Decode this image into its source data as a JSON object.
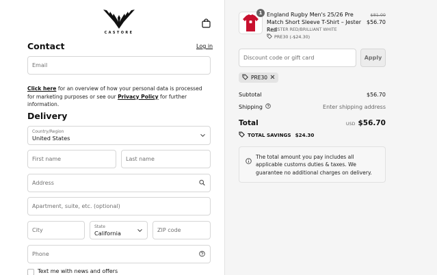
{
  "header": {
    "brand": "CASTORE"
  },
  "contact": {
    "heading": "Contact",
    "login_label": "Log in",
    "email_placeholder": "Email"
  },
  "privacy_note": {
    "link1": "Click here",
    "text1": " for an overview of how your personal data is processed for marketing purposes or see our ",
    "link2": "Privacy Policy",
    "text2": " for further information."
  },
  "delivery": {
    "heading": "Delivery",
    "country_label": "Country/Region",
    "country_value": "United States",
    "first_name_placeholder": "First name",
    "last_name_placeholder": "Last name",
    "address_placeholder": "Address",
    "apartment_placeholder": "Apartment, suite, etc. (optional)",
    "city_placeholder": "City",
    "state_label": "State",
    "state_value": "California",
    "zip_placeholder": "ZIP code",
    "phone_placeholder": "Phone",
    "sms_label": "Text me with news and offers"
  },
  "cart": {
    "item": {
      "quantity": "1",
      "name": "England Rugby Men's 25/26 Pre Match Short Sleeve T-Shirt – Jester Red",
      "variant": "S / JESTER RED/BRILLIANT WHITE",
      "discount": "PRE30 (-$24.30)",
      "original_price": "$81.00",
      "price": "$56.70"
    },
    "discount_placeholder": "Discount code or gift card",
    "apply_label": "Apply",
    "applied_code": "PRE30",
    "subtotal_label": "Subtotal",
    "subtotal_value": "$56.70",
    "shipping_label": "Shipping",
    "shipping_value": "Enter shipping address",
    "total_label": "Total",
    "currency": "USD",
    "total_value": "$56.70",
    "savings_label": "TOTAL SAVINGS",
    "savings_value": "$24.30",
    "info_text": "The total amount you pay includes all applicable customs duties & taxes. We guarantee no additional charges on delivery."
  },
  "colors": {
    "accent": "#111111",
    "background_right": "#f5f5f5",
    "shirt": "#c8102e"
  }
}
